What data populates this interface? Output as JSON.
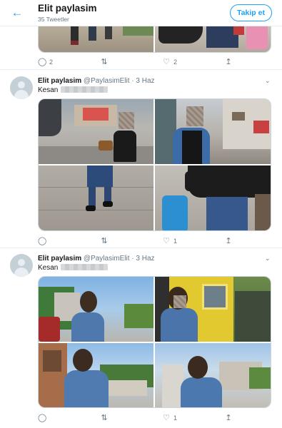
{
  "header": {
    "back_icon": "arrow-left-icon",
    "title": "Elit paylasim",
    "subtitle": "35 Tweetler",
    "follow_label": "Takip et",
    "accent": "#1da1f2"
  },
  "top_tweet_actions": {
    "reply": "2",
    "retweet": "",
    "like": "2"
  },
  "tweets": [
    {
      "name": "Elit paylasim",
      "handle": "@PaylasimElit · 3 Haz",
      "text": "Kesan",
      "actions": {
        "reply": "",
        "retweet": "",
        "like": "1"
      }
    },
    {
      "name": "Elit paylasim",
      "handle": "@PaylasimElit · 3 Haz",
      "text": "Kesan",
      "actions": {
        "reply": "",
        "retweet": "",
        "like": "1"
      }
    }
  ]
}
